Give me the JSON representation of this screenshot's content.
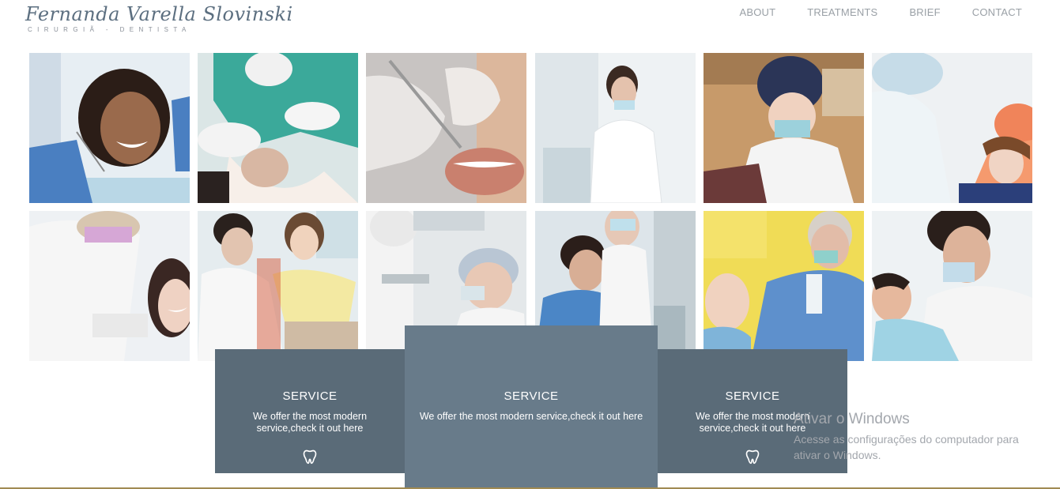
{
  "brand": {
    "name": "Fernanda Varella Slovinski",
    "subtitle": "CIRURGIÃ - DENTISTA"
  },
  "nav": [
    {
      "label": "ABOUT"
    },
    {
      "label": "TREATMENTS"
    },
    {
      "label": "BRIEF"
    },
    {
      "label": "CONTACT"
    }
  ],
  "services": [
    {
      "title": "SERVICE",
      "text": "We offer the most modern service,check it out here",
      "icon": "tooth-icon"
    },
    {
      "title": "SERVICE",
      "text": "We offer the most modern service,check it out here"
    },
    {
      "title": "SERVICE",
      "text": "We offer the most modern service,check it out here",
      "icon": "tooth-icon"
    }
  ],
  "watermark": {
    "title": "Ativar o Windows",
    "text": "Acesse as configurações do computador para ativar o Windows."
  },
  "colors": {
    "card_dark": "#5a6b78",
    "card_mid": "#687b8a",
    "logo": "#5c6f80",
    "accent_line": "#a08a52"
  }
}
